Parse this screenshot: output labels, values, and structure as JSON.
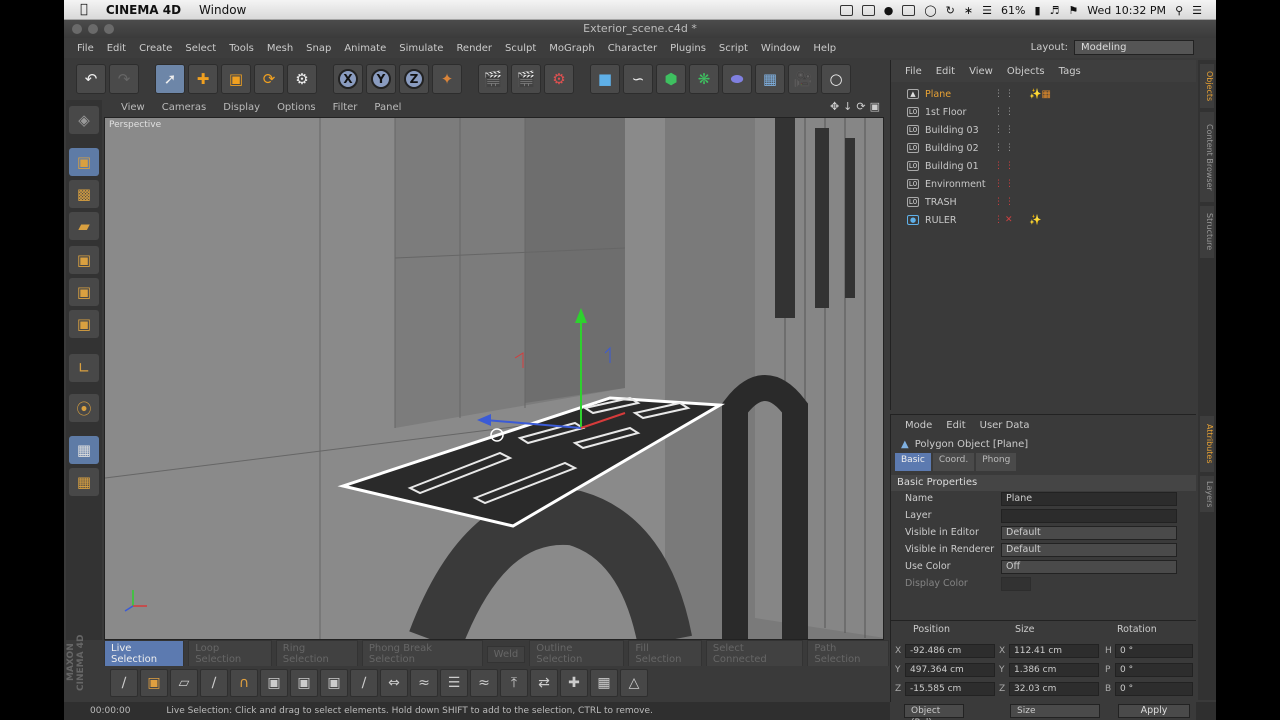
{
  "mac_menubar": {
    "app_name": "CINEMA 4D",
    "menu": "Window",
    "battery": "61%",
    "clock": "Wed 10:32 PM"
  },
  "window": {
    "title": "Exterior_scene.c4d *"
  },
  "main_menu": {
    "items": [
      "File",
      "Edit",
      "Create",
      "Select",
      "Tools",
      "Mesh",
      "Snap",
      "Animate",
      "Simulate",
      "Render",
      "Sculpt",
      "MoGraph",
      "Character",
      "Plugins",
      "Script",
      "Window",
      "Help"
    ],
    "layout_label": "Layout:",
    "layout_value": "Modeling"
  },
  "toolbar": {
    "axis_x": "X",
    "axis_y": "Y",
    "axis_z": "Z"
  },
  "viewport": {
    "menu": [
      "View",
      "Cameras",
      "Display",
      "Options",
      "Filter",
      "Panel"
    ],
    "label": "Perspective"
  },
  "selection_tabs": [
    "Live Selection",
    "Loop Selection",
    "Ring Selection",
    "Phong Break Selection",
    "Weld",
    "Outline Selection",
    "Fill Selection",
    "Select Connected",
    "Path Selection"
  ],
  "status": {
    "time": "00:00:00",
    "message": "Live Selection: Click and drag to select elements. Hold down SHIFT to add to the selection, CTRL to remove."
  },
  "brand": "MAXON CINEMA 4D",
  "object_manager": {
    "menu": [
      "File",
      "Edit",
      "View",
      "Objects",
      "Tags"
    ],
    "objects": [
      {
        "name": "Plane",
        "selected": true
      },
      {
        "name": "1st Floor"
      },
      {
        "name": "Building 03"
      },
      {
        "name": "Building 02"
      },
      {
        "name": "Building 01"
      },
      {
        "name": "Environment"
      },
      {
        "name": "TRASH"
      },
      {
        "name": "RULER"
      }
    ]
  },
  "side_tabs": [
    "Objects",
    "Content Browser",
    "Structure",
    "Attributes",
    "Layers"
  ],
  "attribute_manager": {
    "menu": [
      "Mode",
      "Edit",
      "User Data"
    ],
    "title": "Polygon Object [Plane]",
    "tabs": [
      "Basic",
      "Coord.",
      "Phong"
    ],
    "section": "Basic Properties",
    "props": [
      {
        "label": "Name",
        "value": "Plane"
      },
      {
        "label": "Layer",
        "value": ""
      },
      {
        "label": "Visible in Editor",
        "value": "Default"
      },
      {
        "label": "Visible in Renderer",
        "value": "Default"
      },
      {
        "label": "Use Color",
        "value": "Off"
      },
      {
        "label": "Display Color",
        "value": ""
      }
    ]
  },
  "coordinates": {
    "headers": [
      "Position",
      "Size",
      "Rotation"
    ],
    "pos": {
      "x": "-92.486 cm",
      "y": "497.364 cm",
      "z": "-15.585 cm"
    },
    "size": {
      "x": "112.41 cm",
      "y": "1.386 cm",
      "z": "32.03 cm"
    },
    "rot": {
      "h": "0 °",
      "p": "0 °",
      "b": "0 °"
    },
    "mode": "Object (Rel)",
    "size_mode": "Size",
    "apply": "Apply"
  }
}
